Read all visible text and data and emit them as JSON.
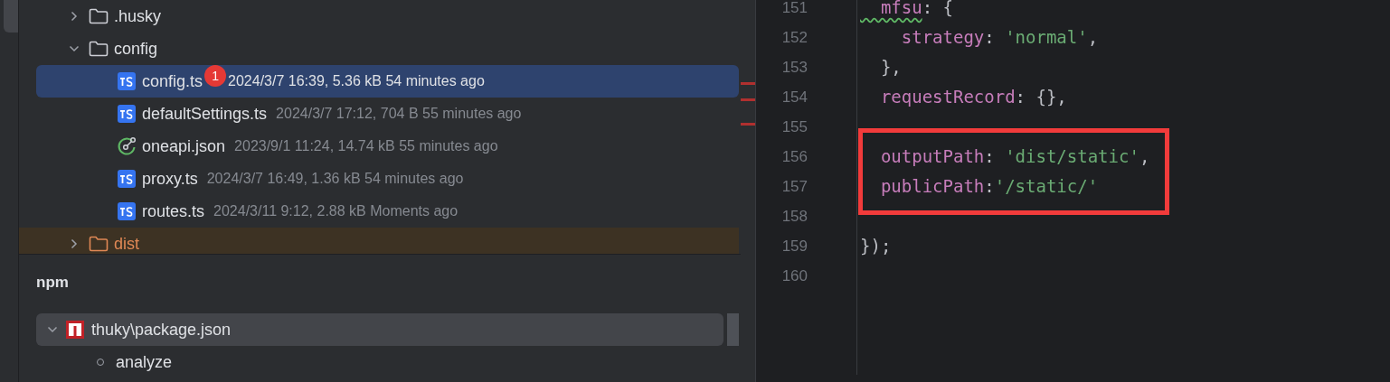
{
  "project_tree": [
    {
      "kind": "folder",
      "label": ".husky",
      "expanded": false,
      "selected": false
    },
    {
      "kind": "folder",
      "label": "config",
      "expanded": true,
      "selected": false,
      "children": [
        {
          "kind": "ts",
          "label": "config.ts",
          "meta": "2024/3/7 16:39, 5.36 kB 54 minutes ago",
          "badge": "1",
          "selected": true
        },
        {
          "kind": "ts",
          "label": "defaultSettings.ts",
          "meta": "2024/3/7 17:12, 704 B 55 minutes ago",
          "selected": false
        },
        {
          "kind": "json",
          "label": "oneapi.json",
          "meta": "2023/9/1 11:24, 14.74 kB 55 minutes ago",
          "selected": false
        },
        {
          "kind": "ts",
          "label": "proxy.ts",
          "meta": "2024/3/7 16:49, 1.36 kB 54 minutes ago",
          "selected": false
        },
        {
          "kind": "ts",
          "label": "routes.ts",
          "meta": "2024/3/11 9:12, 2.88 kB Moments ago",
          "selected": false
        }
      ]
    },
    {
      "kind": "excluded_folder",
      "label": "dist",
      "expanded": false,
      "selected": false
    }
  ],
  "npm": {
    "title": "npm",
    "packages": [
      {
        "label": "thuky\\package.json",
        "expanded": true,
        "scripts": [
          "analyze"
        ]
      }
    ]
  },
  "editor": {
    "lines": [
      {
        "kind": "line",
        "number": "151",
        "tokens": [
          {
            "kind": "key",
            "text": "  mfsu",
            "warning": true
          },
          {
            "kind": "punct",
            "text": ": {"
          }
        ]
      },
      {
        "kind": "line",
        "number": "152",
        "tokens": [
          {
            "kind": "key",
            "text": "    strategy"
          },
          {
            "kind": "punct",
            "text": ": "
          },
          {
            "kind": "string",
            "text": "'normal'"
          },
          {
            "kind": "punct",
            "text": ","
          }
        ]
      },
      {
        "kind": "line",
        "number": "153",
        "tokens": [
          {
            "kind": "punct",
            "text": "  },"
          }
        ]
      },
      {
        "kind": "line",
        "number": "154",
        "tokens": [
          {
            "kind": "key",
            "text": "  requestRecord"
          },
          {
            "kind": "punct",
            "text": ": {},"
          }
        ]
      },
      {
        "kind": "line",
        "number": "155"
      },
      {
        "kind": "boxed_group",
        "lines": [
          {
            "number": "156",
            "tokens": [
              {
                "kind": "key",
                "text": "  outputPath"
              },
              {
                "kind": "punct",
                "text": ": "
              },
              {
                "kind": "string",
                "text": "'dist/static'"
              },
              {
                "kind": "punct",
                "text": ","
              }
            ]
          },
          {
            "number": "157",
            "tokens": [
              {
                "kind": "key",
                "text": "  publicPath"
              },
              {
                "kind": "punct",
                "text": ":"
              },
              {
                "kind": "string",
                "text": "'/static/'"
              }
            ]
          }
        ]
      },
      {
        "kind": "line",
        "number": "158"
      },
      {
        "kind": "line",
        "number": "159",
        "tokens": [
          {
            "kind": "punct",
            "text": "});"
          }
        ]
      },
      {
        "kind": "line",
        "number": "160"
      }
    ]
  }
}
